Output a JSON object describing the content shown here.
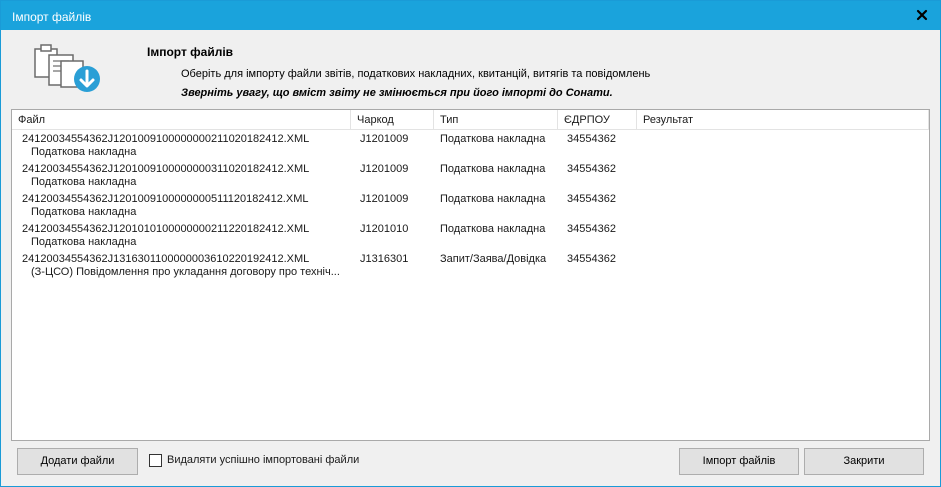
{
  "window": {
    "title": "Імпорт файлів"
  },
  "header": {
    "title": "Імпорт файлів",
    "subtitle": "Оберіть для імпорту файли звітів, податкових накладних, квитанцій, витягів та повідомлень",
    "warning": "Зверніть увагу, що вміст звіту не змінюється при його імпорті до Сонати."
  },
  "table": {
    "columns": [
      "Файл",
      "Чаркод",
      "Тип",
      "ЄДРПОУ",
      "Результат"
    ],
    "rows": [
      {
        "file": "24120034554362J120100910000000021102018241​2.XML",
        "desc": "Податкова накладна",
        "code": "J1201009",
        "type": "Податкова накладна",
        "edrpou": "34554362",
        "result": ""
      },
      {
        "file": "24120034554362J12010091000000003110201824​12.XML",
        "desc": "Податкова накладна",
        "code": "J1201009",
        "type": "Податкова накладна",
        "edrpou": "34554362",
        "result": ""
      },
      {
        "file": "24120034554362J12010091000000005111201824​12.XML",
        "desc": "Податкова накладна",
        "code": "J1201009",
        "type": "Податкова накладна",
        "edrpou": "34554362",
        "result": ""
      },
      {
        "file": "24120034554362J12010101000000002112201824​12.XML",
        "desc": "Податкова накладна",
        "code": "J1201010",
        "type": "Податкова накладна",
        "edrpou": "34554362",
        "result": ""
      },
      {
        "file": "24120034554362J13163011000000036102201924​12.XML",
        "desc": "(З-ЦСО) Повідомлення про укладання договору про техніч...",
        "code": "J1316301",
        "type": "Запит/Заява/Довідка",
        "edrpou": "34554362",
        "result": ""
      }
    ]
  },
  "footer": {
    "add_files": "Додати файли",
    "delete_checkbox": {
      "label": "Видаляти успішно імпортовані файли",
      "checked": false
    },
    "import_files": "Імпорт файлів",
    "close": "Закрити"
  },
  "colors": {
    "titlebar": "#1aa3dc",
    "accent": "#2a9fd6"
  }
}
